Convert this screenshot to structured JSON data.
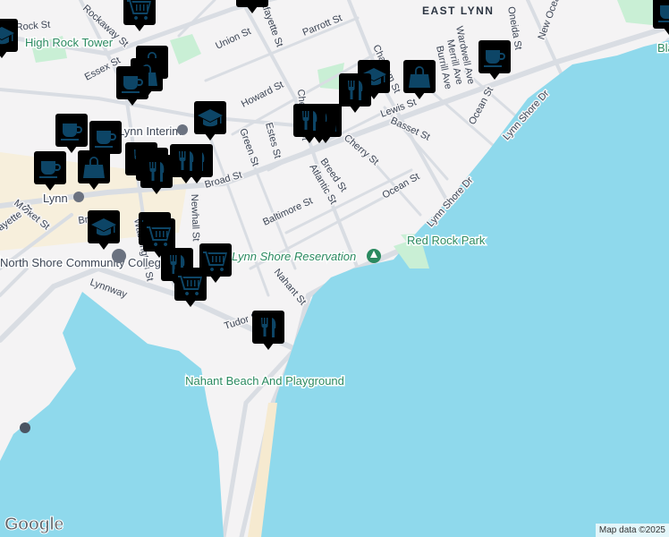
{
  "colors": {
    "water": "#8fd9ec",
    "land": "#f4f3f4",
    "park": "#c9efd5",
    "road": "#d9dde3",
    "marker_fill": "#dfe9fb",
    "marker_icon": "#0d4566",
    "poi_green": "#2b8a60"
  },
  "streets": [
    "Rockaway St",
    "Rock St",
    "Union St",
    "Parrott St",
    "Essex St",
    "Howard St",
    "Green St",
    "Estes St",
    "Broad St",
    "Market St",
    "Newhall St",
    "Baltimore St",
    "Atlantic St",
    "Breed St",
    "Cherry St",
    "Lewis St",
    "Basset St",
    "Ocean St",
    "Ocean St",
    "Lynn Shore Dr",
    "Lynn Shore Dr",
    "Chatham St",
    "Oneida St",
    "Wardwell Ave",
    "Merrill Ave",
    "Burrill Ave",
    "New Ocean St",
    "Nahant St",
    "Tudor St",
    "Lynnway",
    "Washington St",
    "Fayette St",
    "Lafayette St",
    "Broad St",
    "Chestnut St"
  ],
  "places": {
    "high_rock": "High Rock Tower",
    "east_lynn": "EAST LYNN",
    "lynn_interim": "Lynn Interim",
    "lynn": "Lynn",
    "nscc": "North Shore Community College",
    "reservation": "Lynn Shore Reservation",
    "red_rock": "Red Rock Park",
    "nahant_beach": "Nahant Beach And Playground",
    "blaney": "Blaney Willson"
  },
  "markers": [
    "cafe",
    "restaurant",
    "shopping",
    "school",
    "grocery"
  ],
  "footer": {
    "logo": "Google",
    "attribution": "Map data ©2025"
  }
}
